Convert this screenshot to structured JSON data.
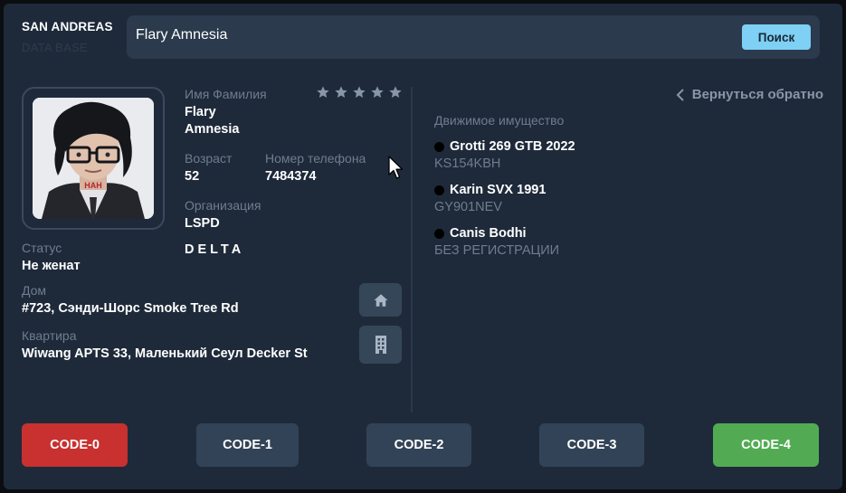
{
  "brand": {
    "title": "SAN ANDREAS",
    "subtitle": "DATA BASE"
  },
  "search": {
    "value": "Flary Amnesia",
    "button_label": "Поиск"
  },
  "profile": {
    "name_label": "Имя Фамилия",
    "first_name": "Flary",
    "last_name": "Amnesia",
    "rating_stars": 5,
    "age_label": "Возраст",
    "age": "52",
    "phone_label": "Номер телефона",
    "phone": "7484374",
    "org_label": "Организация",
    "org": "LSPD",
    "unit": "DELTA",
    "status_label": "Статус",
    "status": "Не женат",
    "house_label": "Дом",
    "house": "#723, Сэнди-Шорс Smoke Tree Rd",
    "apartment_label": "Квартира",
    "apartment": "Wiwang APTS 33, Маленький Сеул Decker St"
  },
  "back_label": "Вернуться обратно",
  "vehicles": {
    "title": "Движимое имущество",
    "items": [
      {
        "name": "Grotti 269 GTB 2022",
        "plate": "KS154KBH"
      },
      {
        "name": "Karin SVX 1991",
        "plate": "GY901NEV"
      },
      {
        "name": "Canis Bodhi",
        "plate": "БЕЗ РЕГИСТРАЦИИ"
      }
    ]
  },
  "codes": [
    {
      "label": "CODE-0",
      "color": "#c8312f"
    },
    {
      "label": "CODE-1",
      "color": "#334357"
    },
    {
      "label": "CODE-2",
      "color": "#334357"
    },
    {
      "label": "CODE-3",
      "color": "#334357"
    },
    {
      "label": "CODE-4",
      "color": "#52ab53"
    }
  ],
  "colors": {
    "panel": "#1e2a3a",
    "search_button": "#7ed0f5",
    "star": "#8796a8"
  },
  "icons": [
    "home-icon",
    "building-icon",
    "chevron-left-icon",
    "star-icon",
    "mouse-cursor-icon"
  ]
}
